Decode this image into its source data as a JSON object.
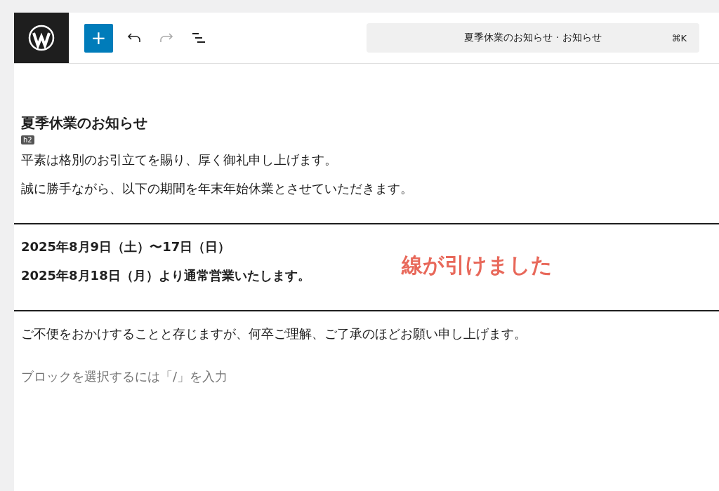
{
  "toolbar": {
    "add_button": "+",
    "document_title": "夏季休業のお知らせ · お知らせ",
    "shortcut": "⌘K",
    "redo_disabled": true
  },
  "blocks": [
    {
      "kind": "heading",
      "text": "夏季休業のお知らせ",
      "tag": "h2"
    },
    {
      "kind": "paragraph",
      "text": "平素は格別のお引立てを賜り、厚く御礼申し上げます。",
      "bold": false
    },
    {
      "kind": "paragraph",
      "text": "誠に勝手ながら、以下の期間を年末年始休業とさせていただきます。",
      "bold": false
    },
    {
      "kind": "separator"
    },
    {
      "kind": "paragraph",
      "text": "2025年8月9日（土）〜17日（日）",
      "bold": true
    },
    {
      "kind": "paragraph",
      "text": "2025年8月18日（月）より通常営業いたします。",
      "bold": true
    },
    {
      "kind": "separator"
    },
    {
      "kind": "paragraph",
      "text": "ご不便をおかけすることと存じますが、何卒ご理解、ご了承のほどお願い申し上げます。",
      "bold": false
    },
    {
      "kind": "placeholder",
      "text": "ブロックを選択するには「/」を入力"
    }
  ],
  "annotation": {
    "text": "線が引けました",
    "color": "#e8685a"
  }
}
